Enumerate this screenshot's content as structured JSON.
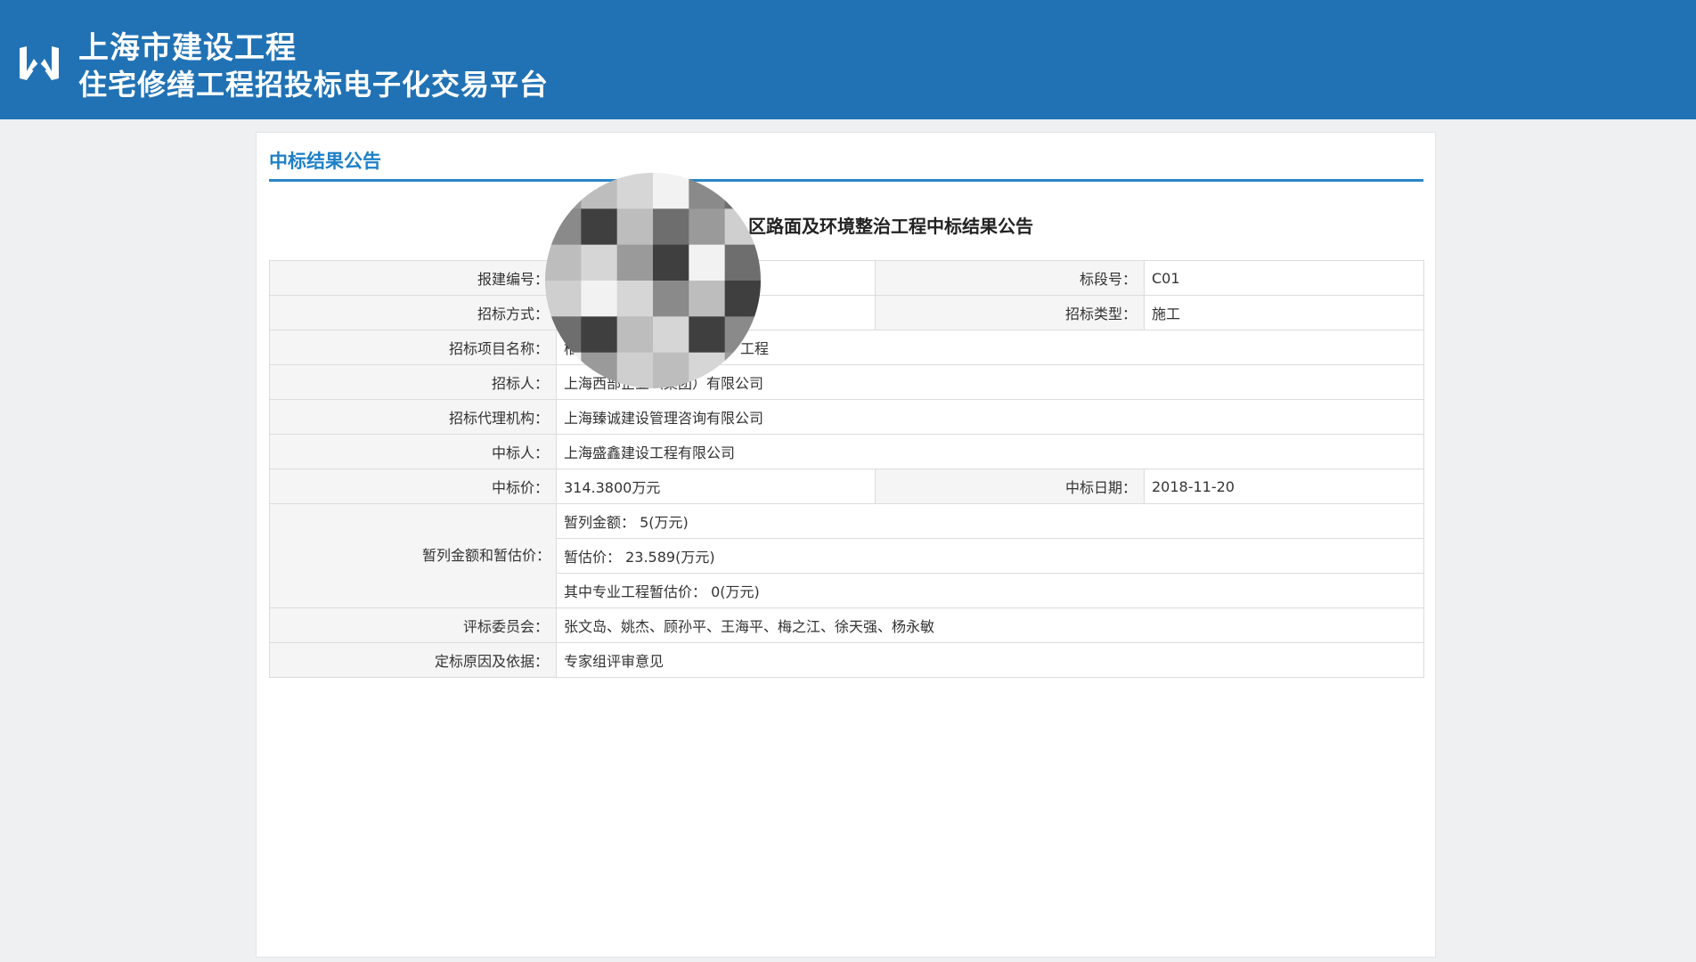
{
  "header": {
    "title_line1": "上海市建设工程",
    "title_line2": "住宅修缮工程招投标电子化交易平台",
    "background": "#2172b4",
    "logo_icon": "platform-logo-icon"
  },
  "panel": {
    "heading": "中标结果公告",
    "accent": "#1f80c6",
    "notice_title_visible": "区路面及环境整治工程中标结果公告"
  },
  "table": {
    "rows": [
      {
        "label": "报建编号：",
        "value": "",
        "label2": "标段号：",
        "value2": "C01"
      },
      {
        "label": "招标方式：",
        "value": "",
        "label2": "招标类型：",
        "value2": "施工"
      },
      {
        "label": "招标项目名称：",
        "value_prefix": "柏",
        "value_suffix": "工程"
      },
      {
        "label": "招标人：",
        "value": "上海西部企业（集团）有限公司"
      },
      {
        "label": "招标代理机构：",
        "value": "上海臻诚建设管理咨询有限公司"
      },
      {
        "label": "中标人：",
        "value": "上海盛鑫建设工程有限公司"
      },
      {
        "label": "中标价：",
        "value": "314.3800万元",
        "label2": "中标日期：",
        "value2": "2018-11-20"
      },
      {
        "label": "暂列金额和暂估价：",
        "sub": [
          "暂列金额：  5(万元)",
          "暂估价：  23.589(万元)",
          "其中专业工程暂估价：  0(万元)"
        ]
      },
      {
        "label": "评标委员会：",
        "value": "张文岛、姚杰、顾孙平、王海平、梅之江、徐天强、杨永敏"
      },
      {
        "label": "定标原因及依据：",
        "value": "专家组评审意见"
      }
    ]
  },
  "privacy_mosaic": {
    "shape": "circle",
    "colors": [
      "#9a9a9a",
      "#bdbdbd",
      "#6e6e6e",
      "#d6d6d6",
      "#3f3f3f",
      "#f2f2f2",
      "#8a8a8a",
      "#cfcfcf"
    ]
  }
}
